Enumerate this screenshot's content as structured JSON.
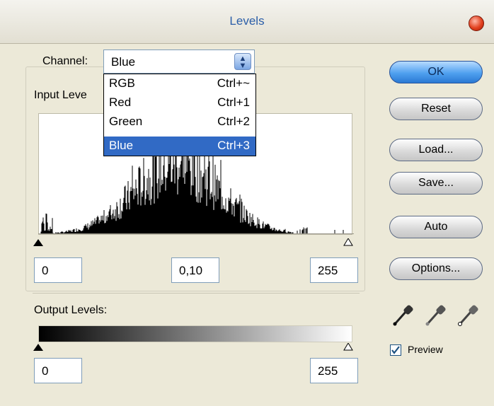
{
  "window": {
    "title": "Levels"
  },
  "channel": {
    "label": "Channel:",
    "selected": "Blue",
    "options": [
      {
        "name": "RGB",
        "shortcut": "Ctrl+~"
      },
      {
        "name": "Red",
        "shortcut": "Ctrl+1"
      },
      {
        "name": "Green",
        "shortcut": "Ctrl+2"
      },
      {
        "name": "Blue",
        "shortcut": "Ctrl+3"
      }
    ]
  },
  "input_levels": {
    "label": "Input Leve",
    "black": "0",
    "gamma": "0,10",
    "white": "255"
  },
  "output_levels": {
    "label": "Output Levels:",
    "black": "0",
    "white": "255"
  },
  "buttons": {
    "ok": "OK",
    "reset": "Reset",
    "load": "Load...",
    "save": "Save...",
    "auto": "Auto",
    "options": "Options..."
  },
  "preview": {
    "label": "Preview",
    "checked": true
  },
  "icons": [
    "close-icon",
    "dropdown-arrow-icon",
    "black-point-eyedropper-icon",
    "gray-point-eyedropper-icon",
    "white-point-eyedropper-icon",
    "checkmark-icon"
  ]
}
